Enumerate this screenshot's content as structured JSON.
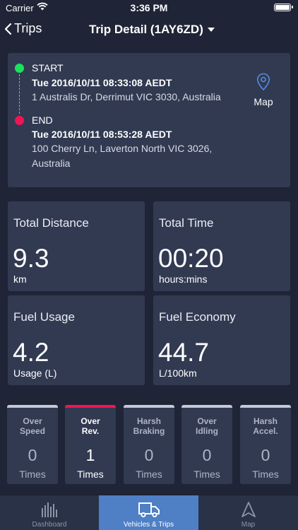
{
  "status_bar": {
    "carrier": "Carrier",
    "time": "3:36 PM"
  },
  "nav": {
    "back_label": "Trips",
    "title": "Trip Detail (1AY6ZD)"
  },
  "trip": {
    "start_label": "START",
    "start_time": "Tue 2016/10/11 08:33:08 AEDT",
    "start_address": "1 Australis Dr, Derrimut VIC 3030, Australia",
    "end_label": "END",
    "end_time": "Tue 2016/10/11 08:53:28 AEDT",
    "end_address": "100 Cherry Ln, Laverton North VIC 3026, Australia",
    "map_label": "Map",
    "start_color": "#19e35a",
    "end_color": "#ef1554"
  },
  "stats": [
    {
      "title": "Total Distance",
      "value": "9.3",
      "unit": "km"
    },
    {
      "title": "Total Time",
      "value": "00:20",
      "unit": "hours:mins"
    },
    {
      "title": "Fuel Usage",
      "value": "4.2",
      "unit": "Usage (L)"
    },
    {
      "title": "Fuel Economy",
      "value": "44.7",
      "unit": "L/100km"
    }
  ],
  "metrics": [
    {
      "line1": "Over",
      "line2": "Speed",
      "value": "0",
      "unit": "Times"
    },
    {
      "line1": "Over",
      "line2": "Rev.",
      "value": "1",
      "unit": "Times"
    },
    {
      "line1": "Harsh",
      "line2": "Braking",
      "value": "0",
      "unit": "Times"
    },
    {
      "line1": "Over",
      "line2": "Idling",
      "value": "0",
      "unit": "Times"
    },
    {
      "line1": "Harsh",
      "line2": "Accel.",
      "value": "0",
      "unit": "Times"
    }
  ],
  "tabs": [
    {
      "label": "Dashboard",
      "icon": "bar-chart-icon"
    },
    {
      "label": "Vehicles & Trips",
      "icon": "truck-icon"
    },
    {
      "label": "Map",
      "icon": "navigation-arrow-icon"
    }
  ],
  "colors": {
    "background": "#1f2536",
    "card": "#323a52",
    "accent": "#ef1554",
    "tab_active": "#4f7fc5"
  }
}
